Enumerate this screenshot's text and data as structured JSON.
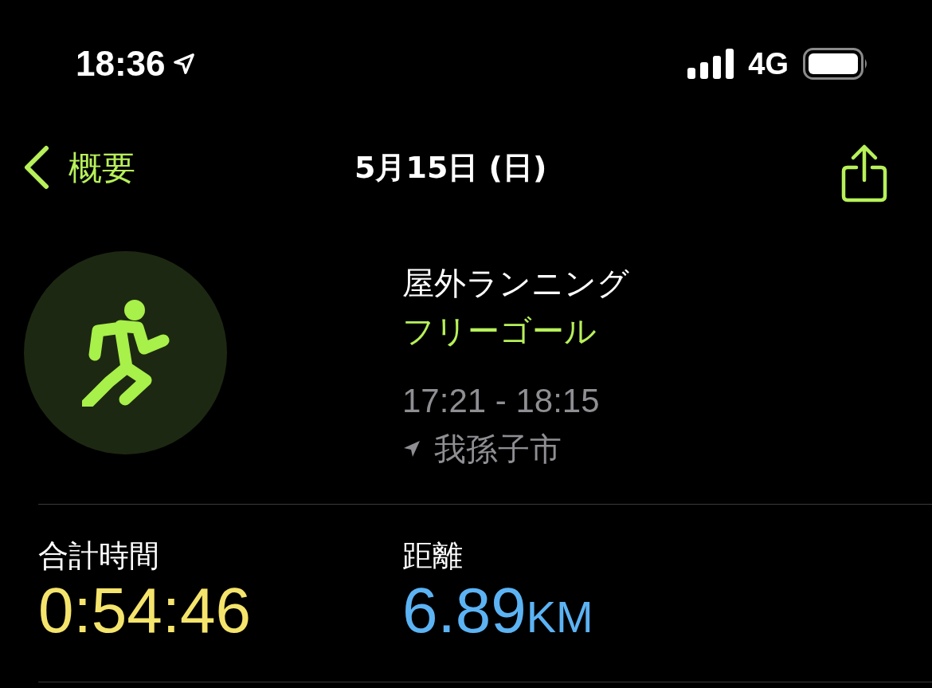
{
  "status_bar": {
    "time": "18:36",
    "network": "4G"
  },
  "nav": {
    "back": "概要",
    "title": "5月15日 (日)"
  },
  "workout": {
    "type": "屋外ランニング",
    "goal": "フリーゴール",
    "time_range": "17:21 - 18:15",
    "location": "我孫子市"
  },
  "metrics": [
    {
      "label": "合計時間",
      "value": "0:54:46",
      "color": "#f5e46c"
    },
    {
      "label": "距離",
      "value": "6.89",
      "unit": "KM",
      "color": "#5cb3f4"
    }
  ]
}
